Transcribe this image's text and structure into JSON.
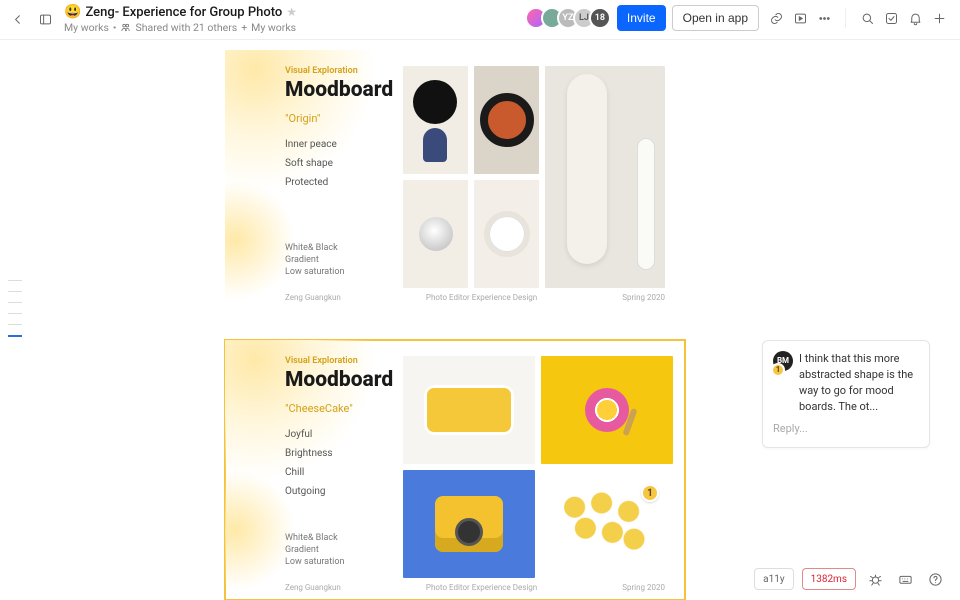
{
  "header": {
    "emoji": "😃",
    "title": "Zeng- Experience for Group Photo",
    "breadcrumb1": "My works",
    "shared": "Shared with 21 others",
    "breadcrumb2": "My works",
    "avatar_initials": [
      "",
      "",
      "YZ",
      "LJ"
    ],
    "avatar_overflow": "18",
    "invite_label": "Invite",
    "open_label": "Open in app"
  },
  "board1": {
    "overline": "Visual Exploration",
    "title": "Moodboard",
    "subname": "\"Origin\"",
    "keywords": [
      "Inner peace",
      "Soft shape",
      "Protected"
    ],
    "notes": [
      "White& Black",
      "Gradient",
      "Low saturation"
    ],
    "credit_left": "Zeng Guangkun",
    "credit_mid": "Photo Editor Experience Design",
    "credit_right": "Spring 2020"
  },
  "board2": {
    "overline": "Visual Exploration",
    "title": "Moodboard",
    "subname": "\"CheeseCake\"",
    "keywords": [
      "Joyful",
      "Brightness",
      "Chill",
      "Outgoing"
    ],
    "notes": [
      "White& Black",
      "Gradient",
      "Low saturation"
    ],
    "credit_left": "Zeng Guangkun",
    "credit_mid": "Photo Editor Experience Design",
    "credit_right": "Spring 2020",
    "comment_count": "1"
  },
  "comment": {
    "avatar": "BM",
    "badge": "1",
    "text": "I think that this more abstracted shape is the way to go for mood boards. The ot...",
    "reply": "Reply..."
  },
  "footer": {
    "a11y": "a11y",
    "timing": "1382ms"
  }
}
